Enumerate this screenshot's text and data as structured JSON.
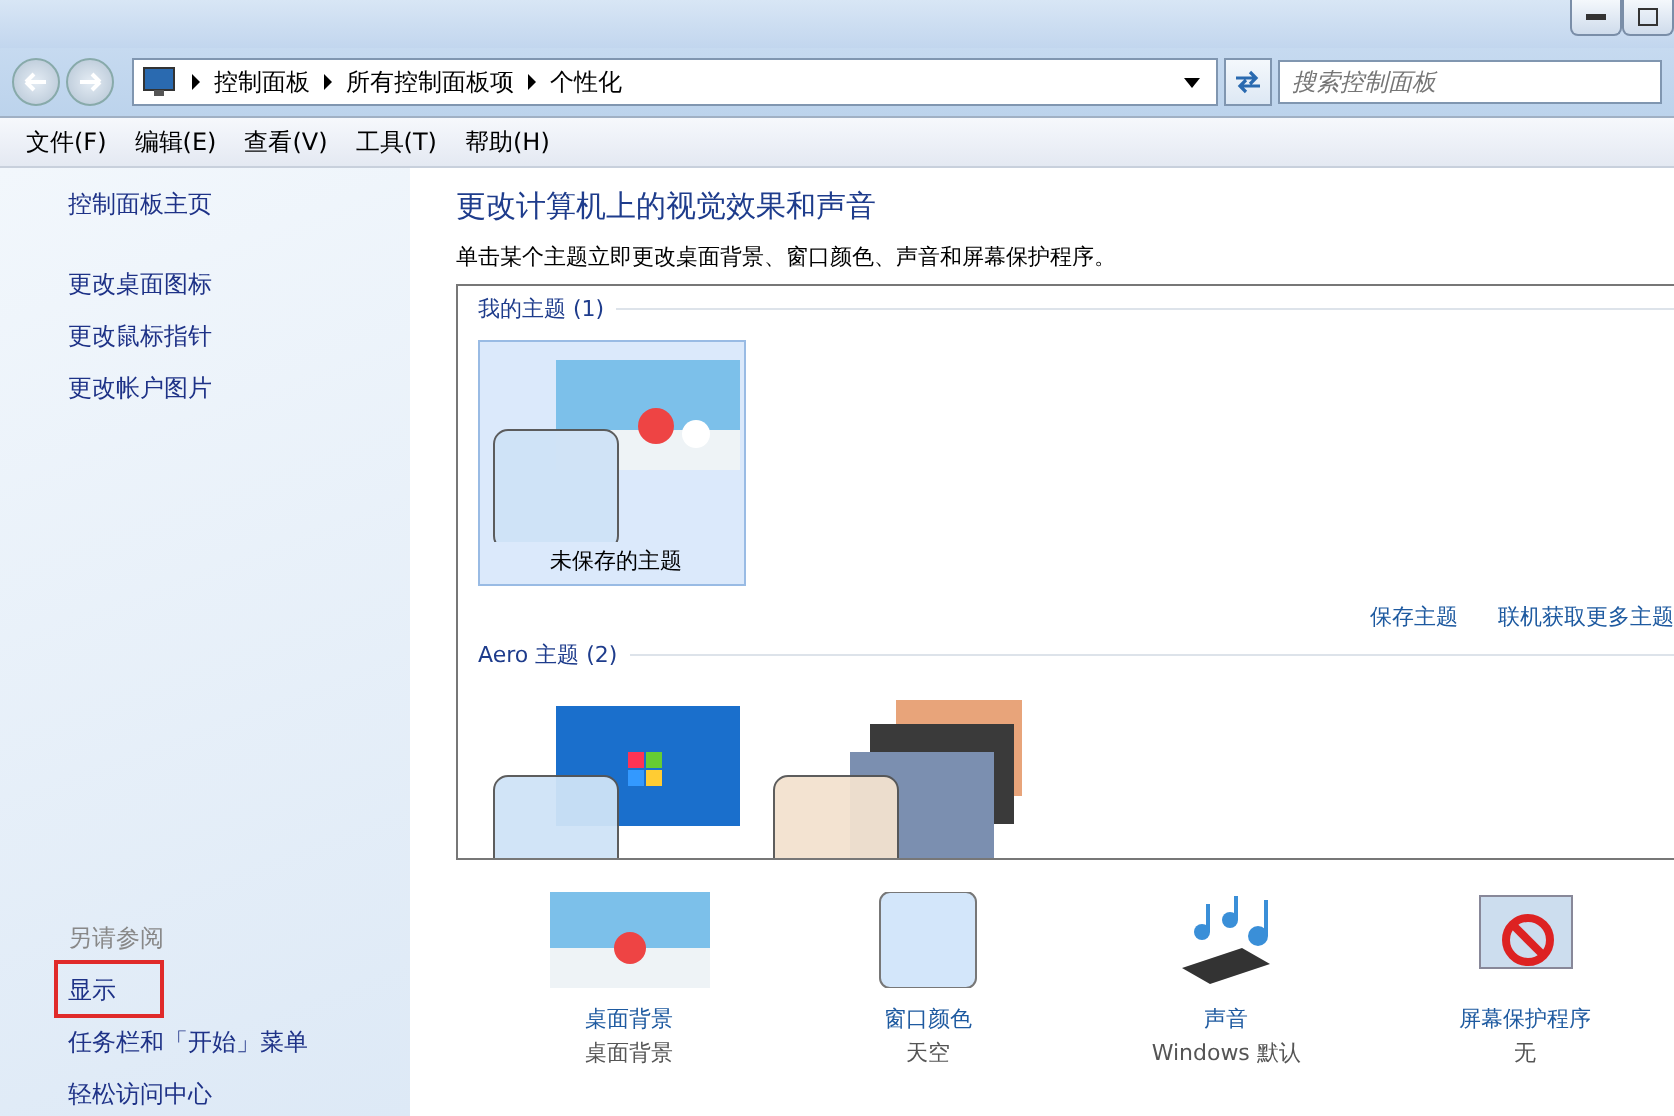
{
  "address_bar": {
    "breadcrumbs": [
      "控制面板",
      "所有控制面板项",
      "个性化"
    ]
  },
  "search": {
    "placeholder": "搜索控制面板"
  },
  "menu": [
    "文件(F)",
    "编辑(E)",
    "查看(V)",
    "工具(T)",
    "帮助(H)"
  ],
  "sidebar": {
    "home": "控制面板主页",
    "links": [
      "更改桌面图标",
      "更改鼠标指针",
      "更改帐户图片"
    ],
    "see_also_heading": "另请参阅",
    "see_also": [
      {
        "label": "显示",
        "highlighted": true
      },
      {
        "label": "任务栏和「开始」菜单",
        "highlighted": false
      },
      {
        "label": "轻松访问中心",
        "highlighted": false
      }
    ]
  },
  "main": {
    "title": "更改计算机上的视觉效果和声音",
    "description": "单击某个主题立即更改桌面背景、窗口颜色、声音和屏幕保护程序。",
    "groups": [
      {
        "name": "我的主题 (1)",
        "themes": [
          {
            "kind": "cartoon",
            "label": "未保存的主题",
            "selected": true
          }
        ],
        "actions": [
          "保存主题",
          "联机获取更多主题"
        ]
      },
      {
        "name": "Aero 主题 (2)",
        "themes": [
          {
            "kind": "windows",
            "selected": false
          },
          {
            "kind": "landscapes",
            "selected": false
          }
        ]
      }
    ],
    "settings": [
      {
        "kind": "background",
        "label": "桌面背景",
        "value": "桌面背景"
      },
      {
        "kind": "color",
        "label": "窗口颜色",
        "value": "天空"
      },
      {
        "kind": "sound",
        "label": "声音",
        "value": "Windows 默认"
      },
      {
        "kind": "screensaver",
        "label": "屏幕保护程序",
        "value": "无"
      }
    ]
  }
}
